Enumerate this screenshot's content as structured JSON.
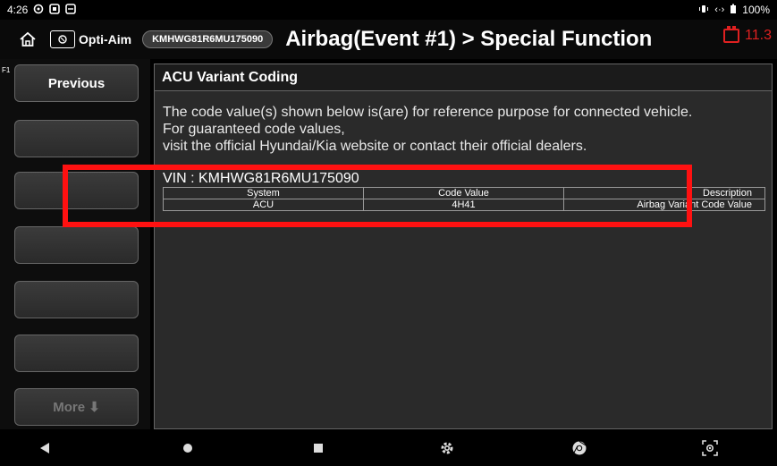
{
  "statusbar": {
    "time": "4:26",
    "left_icons": [
      "location-icon",
      "notification-icon",
      "message-icon"
    ],
    "right_icons": [
      "vibrate-icon",
      "data-icon"
    ],
    "battery": "100%"
  },
  "header": {
    "app_label": "Opti-Aim",
    "vin_pill": "KMHWG81R6MU175090",
    "title": "Airbag(Event #1) > Special Function",
    "battery_voltage": "11.3"
  },
  "function_keys": {
    "f1_label": "F1",
    "buttons": [
      {
        "label": "Previous",
        "enabled": true
      },
      {
        "label": "",
        "enabled": true
      },
      {
        "label": "",
        "enabled": true
      },
      {
        "label": "",
        "enabled": true
      },
      {
        "label": "",
        "enabled": true
      },
      {
        "label": "",
        "enabled": true
      },
      {
        "label": "More ⬇",
        "enabled": false
      }
    ]
  },
  "panel": {
    "title": "ACU Variant Coding",
    "notice_lines": [
      "The code value(s) shown below is(are) for reference purpose for connected vehicle.",
      "For guaranteed code values,",
      "visit the official Hyundai/Kia website or contact their official dealers."
    ],
    "vin_line": "VIN : KMHWG81R6MU175090",
    "table": {
      "headers": [
        "System",
        "Code Value",
        "Description"
      ],
      "rows": [
        [
          "ACU",
          "4H41",
          "Airbag Variant Code Value"
        ]
      ]
    }
  },
  "colors": {
    "highlight": "#ff1111",
    "battery_warning": "#e02020"
  },
  "navbar": {
    "icons": [
      "back-icon",
      "home-circle-icon",
      "recents-icon",
      "settings-gear-icon",
      "chrome-icon",
      "screenshot-icon"
    ]
  }
}
